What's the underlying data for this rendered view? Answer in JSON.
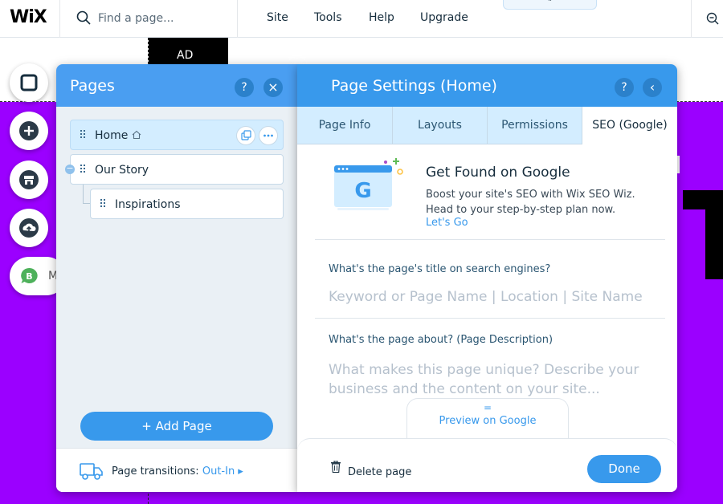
{
  "topbar": {
    "logo": "WiX",
    "search_placeholder": "Find a page...",
    "menu": [
      "Site",
      "Tools",
      "Help",
      "Upgrade"
    ],
    "collapse_caret": "˄"
  },
  "canvas": {
    "ad_label": "AD",
    "background_color": "#9b00ff"
  },
  "left_rail": {
    "tools": [
      "pages-menu-icon",
      "add-icon",
      "store-icon",
      "upload-icon"
    ],
    "chat_badge": "B",
    "chat_label": "M"
  },
  "pages_panel": {
    "title": "Pages",
    "help_label": "?",
    "close_label": "×",
    "pages": [
      {
        "label": "Home",
        "selected": true
      },
      {
        "label": "Our Story",
        "selected": false
      },
      {
        "label": "Inspirations",
        "selected": false
      }
    ],
    "collapse_symbol": "−",
    "add_page_label": "+ Add Page",
    "transitions_label": "Page transitions:",
    "transitions_value": "Out-In ▸"
  },
  "settings_panel": {
    "title": "Page Settings (Home)",
    "help_label": "?",
    "back_label": "‹",
    "tabs": [
      "Page Info",
      "Layouts",
      "Permissions",
      "SEO (Google)"
    ],
    "active_tab": "SEO (Google)",
    "promo": {
      "title": "Get Found on Google",
      "text_line1": "Boost your site's SEO with Wix SEO Wiz.",
      "text_line2": "Head to your step-by-step plan now.",
      "link": "Let's Go"
    },
    "seo_title_label": "What's the page's title on search engines?",
    "seo_title_placeholder": "Keyword or Page Name | Location | Site Name",
    "seo_desc_label": "What's the page about? (Page Description)",
    "seo_desc_placeholder": "What makes this page unique? Describe your business and the content on your site...",
    "preview_handle": "=",
    "preview_label": "Preview on Google",
    "delete_label": "Delete page",
    "done_label": "Done"
  },
  "colors": {
    "accent": "#3899ec",
    "header_blue": "#4a9ef1",
    "tab_bg": "#d3edff",
    "canvas_purple": "#9b00ff"
  }
}
